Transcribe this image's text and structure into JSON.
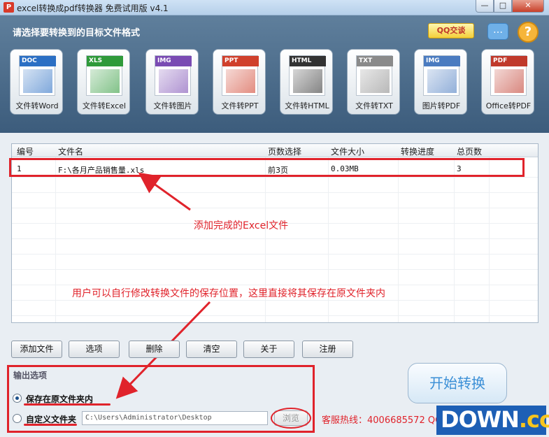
{
  "window": {
    "title": "excel转换成pdf转换器 免费试用版 v4.1",
    "min": "—",
    "max": "□",
    "close": "✕"
  },
  "header": {
    "title": "请选择要转换到的目标文件格式",
    "qq_badge": "QQ交谈",
    "help_glyph": "?"
  },
  "tiles": [
    {
      "tag": "DOC",
      "label": "文件转Word",
      "color": "#2b6fc4"
    },
    {
      "tag": "XLS",
      "label": "文件转Excel",
      "color": "#2f9a3a"
    },
    {
      "tag": "IMG",
      "label": "文件转图片",
      "color": "#7a4bb3"
    },
    {
      "tag": "PPT",
      "label": "文件转PPT",
      "color": "#d0402c"
    },
    {
      "tag": "HTML",
      "label": "文件转HTML",
      "color": "#333333"
    },
    {
      "tag": "TXT",
      "label": "文件转TXT",
      "color": "#8a8a8a"
    },
    {
      "tag": "IMG",
      "label": "图片转PDF",
      "color": "#4a7bc0"
    },
    {
      "tag": "PDF",
      "label": "Office转PDF",
      "color": "#c0392b"
    }
  ],
  "table": {
    "headers": [
      "编号",
      "文件名",
      "页数选择",
      "文件大小",
      "转换进度",
      "总页数"
    ],
    "rows": [
      {
        "num": "1",
        "name": "F:\\各月产品销售量.xls",
        "pages": "前3页",
        "size": "0.03MB",
        "progress": "",
        "total": "3"
      }
    ]
  },
  "annotations": {
    "added": "添加完成的Excel文件",
    "save_note": "用户可以自行修改转换文件的保存位置，这里直接将其保存在原文件夹内"
  },
  "buttons": {
    "add": "添加文件",
    "options": "选项",
    "delete": "删除",
    "clear": "清空",
    "about": "关于",
    "register": "注册"
  },
  "output": {
    "title": "输出选项",
    "opt_original": "保存在原文件夹内",
    "opt_custom": "自定义文件夹",
    "path": "C:\\Users\\Administrator\\Desktop",
    "browse": "浏览",
    "selected": "original"
  },
  "start": "开始转换",
  "hotline": "客服热线：4006685572 QQ",
  "watermark": {
    "main": "DOWN",
    "suffix": ".cc"
  }
}
